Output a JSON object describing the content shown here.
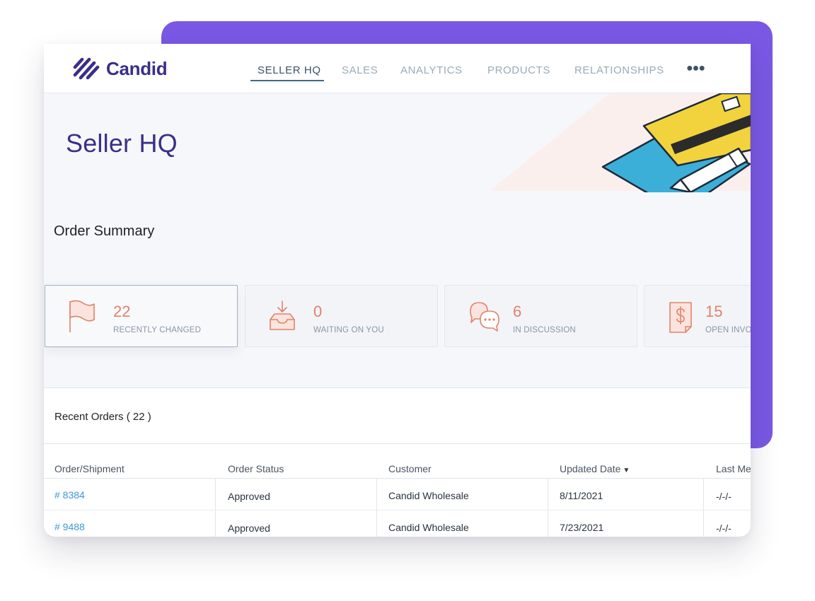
{
  "brand": {
    "name": "Candid"
  },
  "nav": {
    "items": [
      {
        "label": "SELLER HQ",
        "active": true
      },
      {
        "label": "SALES",
        "active": false
      },
      {
        "label": "ANALYTICS",
        "active": false
      },
      {
        "label": "PRODUCTS",
        "active": false
      },
      {
        "label": "RELATIONSHIPS",
        "active": false
      }
    ],
    "more_icon": "more-dots-icon"
  },
  "page": {
    "title": "Seller HQ"
  },
  "order_summary": {
    "title": "Order Summary",
    "tiles": [
      {
        "count": "22",
        "label": "RECENTLY CHANGED",
        "icon": "flag-icon",
        "selected": true
      },
      {
        "count": "0",
        "label": "WAITING ON YOU",
        "icon": "inbox-download-icon",
        "selected": false
      },
      {
        "count": "6",
        "label": "IN DISCUSSION",
        "icon": "chat-bubbles-icon",
        "selected": false
      },
      {
        "count": "15",
        "label": "OPEN INVO",
        "icon": "invoice-dollar-icon",
        "selected": false
      }
    ]
  },
  "recent_orders": {
    "title": "Recent Orders ( 22 )",
    "columns": [
      "Order/Shipment",
      "Order Status",
      "Customer",
      "Updated Date",
      "Last Me"
    ],
    "sort_icon": "sort-down-icon",
    "rows": [
      {
        "order": "# 8384",
        "status": "Approved",
        "customer": "Candid Wholesale",
        "updated": "8/11/2021",
        "last": "-/-/-"
      },
      {
        "order": "# 9488",
        "status": "Approved",
        "customer": "Candid Wholesale",
        "updated": "7/23/2021",
        "last": "-/-/-"
      }
    ]
  },
  "colors": {
    "accent_purple": "#7a58e4",
    "brand_navy": "#3a2e8a",
    "tile_accent": "#e0836a",
    "link_blue": "#3a9ad4"
  }
}
